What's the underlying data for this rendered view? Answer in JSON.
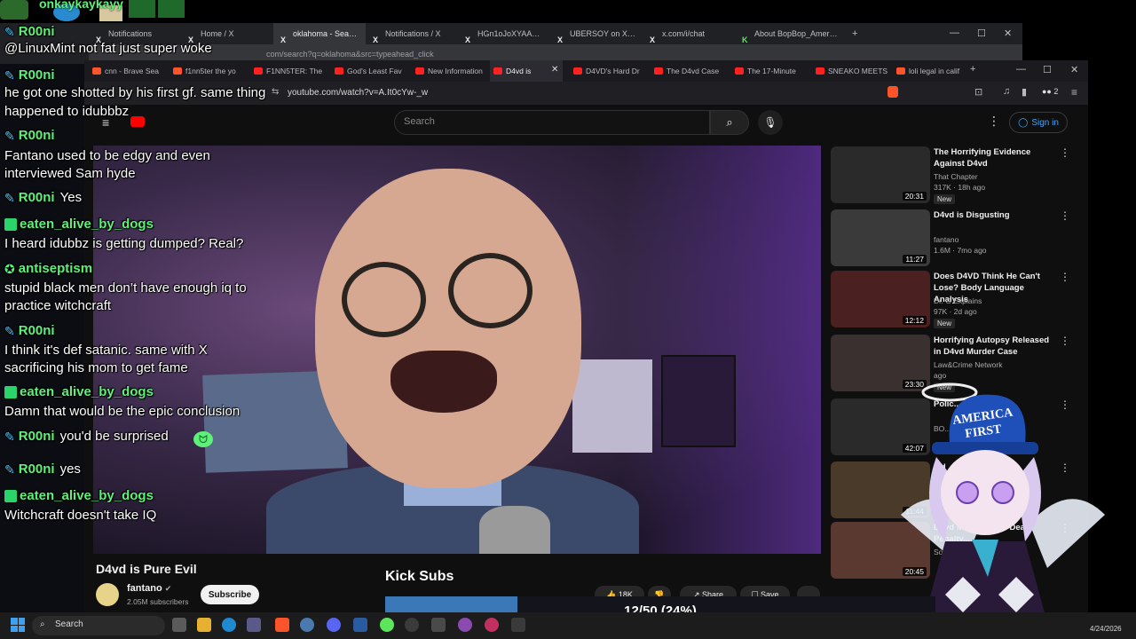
{
  "top_bar": {
    "streamer_name": "onkaykaykayy"
  },
  "back_browser": {
    "tabs": [
      "Notifications",
      "Home / X",
      "oklahoma - Search /",
      "Notifications / X",
      "HGn1oJoXYAAyNbt (188",
      "UBERSOY on X: \"1. Watch",
      "x.com/i/chat",
      "About BopBop_America"
    ],
    "url": "com/search?q=oklahoma&src=typeahead_click"
  },
  "main_browser": {
    "tabs": [
      "cnn - Brave Sea",
      "f1nn5ter the yo",
      "F1NN5TER: The",
      "God's Least Fav",
      "New Information",
      "D4vd is",
      "D4VD's Hard Dr",
      "The D4vd Case",
      "The 17-Minute",
      "SNEAKO MEETS",
      "loli legal in calif"
    ],
    "url": "youtube.com/watch?v=A.It0cYw-_w",
    "extensions_count": "2"
  },
  "youtube": {
    "search_placeholder": "Search",
    "sign_in": "Sign in",
    "video_title": "D4vd is Pure Evil",
    "channel": "fantano",
    "subscribers": "2.05M subscribers",
    "subscribe": "Subscribe",
    "likes": "18K",
    "share": "Share",
    "save": "Save",
    "recommendations": [
      {
        "title": "The Horrifying Evidence Against D4vd",
        "channel": "That Chapter",
        "meta": "317K · 18h ago",
        "duration": "20:31",
        "badge": "New",
        "thumb_color": "#2a2a2a"
      },
      {
        "title": "D4vd is Disgusting",
        "channel": "fantano",
        "meta": "1.6M · 7mo ago",
        "duration": "11:27",
        "badge": "",
        "thumb_color": "#3a3a3a"
      },
      {
        "title": "Does D4VD Think He Can't Lose? Body Language Analysis",
        "channel": "Dr. G Explains",
        "meta": "97K · 2d ago",
        "duration": "12:12",
        "badge": "New",
        "thumb_color": "#4a2020"
      },
      {
        "title": "Horrifying Autopsy Released in D4vd Murder Case",
        "channel": "Law&Crime Network",
        "meta": "ago",
        "duration": "23:30",
        "badge": "New",
        "thumb_color": "#3a3030"
      },
      {
        "title": "Polic... Disc... His ...",
        "channel": "BO...",
        "meta": "",
        "duration": "42:07",
        "badge": "",
        "thumb_color": "#2a2a2a"
      },
      {
        "title": "...d",
        "channel": "",
        "meta": "",
        "duration": "11:44",
        "badge": "",
        "thumb_color": "#4a3a2a"
      },
      {
        "title": "D4vd Might G... he Death Penalty...",
        "channel": "Some...",
        "meta": "",
        "duration": "20:45",
        "badge": "",
        "thumb_color": "#5a3a30"
      }
    ]
  },
  "chat": [
    {
      "user": "R00ni",
      "badge": "wrench",
      "msg": ""
    },
    {
      "user": "",
      "badge": "",
      "msg": "@LinuxMint not fat just super woke"
    },
    {
      "user": "R00ni",
      "badge": "wrench",
      "msg": ""
    },
    {
      "user": "",
      "badge": "",
      "msg": "he got one shotted by his first gf. same thing"
    },
    {
      "user": "",
      "badge": "",
      "msg": "happened to idubbbz"
    },
    {
      "user": "R00ni",
      "badge": "wrench",
      "msg": ""
    },
    {
      "user": "",
      "badge": "",
      "msg": "Fantano used to be edgy and even"
    },
    {
      "user": "",
      "badge": "",
      "msg": "interviewed Sam hyde"
    },
    {
      "user": "R00ni",
      "badge": "wrench",
      "msg": "Yes"
    },
    {
      "user": "eaten_alive_by_dogs",
      "badge": "box",
      "msg": ""
    },
    {
      "user": "",
      "badge": "",
      "msg": "I heard idubbz is getting dumped? Real?"
    },
    {
      "user": "antiseptism",
      "badge": "star",
      "msg": ""
    },
    {
      "user": "",
      "badge": "",
      "msg": "stupid black men don’t have enough iq to"
    },
    {
      "user": "",
      "badge": "",
      "msg": "practice witchcraft"
    },
    {
      "user": "R00ni",
      "badge": "wrench",
      "msg": ""
    },
    {
      "user": "",
      "badge": "",
      "msg": "I think it's def satanic. same with X"
    },
    {
      "user": "",
      "badge": "",
      "msg": "sacrificing his mom to get fame"
    },
    {
      "user": "eaten_alive_by_dogs",
      "badge": "box",
      "msg": ""
    },
    {
      "user": "",
      "badge": "",
      "msg": "Damn that would be the epic conclusion"
    },
    {
      "user": "R00ni",
      "badge": "wrench",
      "msg": "you'd be surprised"
    },
    {
      "user": "R00ni",
      "badge": "wrench",
      "msg": "yes"
    },
    {
      "user": "eaten_alive_by_dogs",
      "badge": "box",
      "msg": ""
    },
    {
      "user": "",
      "badge": "",
      "msg": "Witchcraft doesn't take IQ"
    }
  ],
  "kick_subs": {
    "label": "Kick Subs",
    "progress_text": "12/50 (24%)",
    "progress": 0.24
  },
  "avatar_hat": {
    "line1": "AMERICA",
    "line2": "FIRST"
  },
  "taskbar": {
    "search": "Search",
    "date": "4/24/2026"
  },
  "colors": {
    "chat_name": "#5ff07a",
    "yt_red": "#ff0000",
    "kick_bar": "#3a78b8",
    "signin_blue": "#3ea6ff"
  }
}
